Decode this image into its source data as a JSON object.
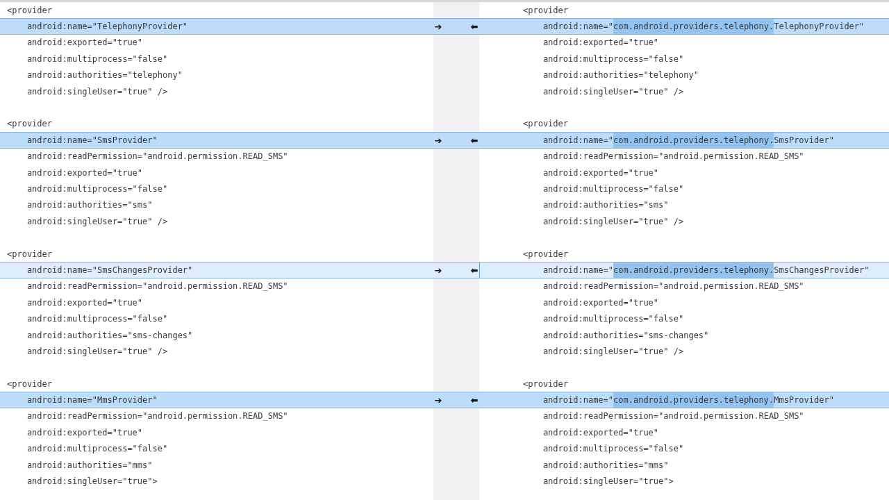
{
  "diff": {
    "blocks": [
      {
        "rows": [
          {
            "left": "<provider",
            "right": [
              {
                "text": "<provider",
                "inserted": false
              }
            ],
            "changed": false,
            "selected": false
          },
          {
            "left": "    android:name=\"TelephonyProvider\"",
            "right": [
              {
                "text": "    android:name=\"",
                "inserted": false
              },
              {
                "text": "com.android.providers.telephony.",
                "inserted": true
              },
              {
                "text": "TelephonyProvider\"",
                "inserted": false
              }
            ],
            "changed": true,
            "selected": false,
            "merge_right": "➔",
            "merge_left": "⬅"
          },
          {
            "left": "    android:exported=\"true\"",
            "right": [
              {
                "text": "    android:exported=\"true\"",
                "inserted": false
              }
            ],
            "changed": false,
            "selected": false
          },
          {
            "left": "    android:multiprocess=\"false\"",
            "right": [
              {
                "text": "    android:multiprocess=\"false\"",
                "inserted": false
              }
            ],
            "changed": false,
            "selected": false
          },
          {
            "left": "    android:authorities=\"telephony\"",
            "right": [
              {
                "text": "    android:authorities=\"telephony\"",
                "inserted": false
              }
            ],
            "changed": false,
            "selected": false
          },
          {
            "left": "    android:singleUser=\"true\" />",
            "right": [
              {
                "text": "    android:singleUser=\"true\" />",
                "inserted": false
              }
            ],
            "changed": false,
            "selected": false
          }
        ]
      },
      {
        "rows": [
          {
            "left": "<provider",
            "right": [
              {
                "text": "<provider",
                "inserted": false
              }
            ],
            "changed": false,
            "selected": false
          },
          {
            "left": "    android:name=\"SmsProvider\"",
            "right": [
              {
                "text": "    android:name=\"",
                "inserted": false
              },
              {
                "text": "com.android.providers.telephony.",
                "inserted": true
              },
              {
                "text": "SmsProvider\"",
                "inserted": false
              }
            ],
            "changed": true,
            "selected": false,
            "merge_right": "➔",
            "merge_left": "⬅"
          },
          {
            "left": "    android:readPermission=\"android.permission.READ_SMS\"",
            "right": [
              {
                "text": "    android:readPermission=\"android.permission.READ_SMS\"",
                "inserted": false
              }
            ],
            "changed": false,
            "selected": false
          },
          {
            "left": "    android:exported=\"true\"",
            "right": [
              {
                "text": "    android:exported=\"true\"",
                "inserted": false
              }
            ],
            "changed": false,
            "selected": false
          },
          {
            "left": "    android:multiprocess=\"false\"",
            "right": [
              {
                "text": "    android:multiprocess=\"false\"",
                "inserted": false
              }
            ],
            "changed": false,
            "selected": false
          },
          {
            "left": "    android:authorities=\"sms\"",
            "right": [
              {
                "text": "    android:authorities=\"sms\"",
                "inserted": false
              }
            ],
            "changed": false,
            "selected": false
          },
          {
            "left": "    android:singleUser=\"true\" />",
            "right": [
              {
                "text": "    android:singleUser=\"true\" />",
                "inserted": false
              }
            ],
            "changed": false,
            "selected": false
          }
        ]
      },
      {
        "rows": [
          {
            "left": "<provider",
            "right": [
              {
                "text": "<provider",
                "inserted": false
              }
            ],
            "changed": false,
            "selected": false
          },
          {
            "left": "    android:name=\"SmsChangesProvider\"",
            "right": [
              {
                "text": "    android:name=\"",
                "inserted": false
              },
              {
                "text": "com.android.providers.telephony.",
                "inserted": true
              },
              {
                "text": "SmsChangesProvider\"",
                "inserted": false
              }
            ],
            "changed": true,
            "selected": true,
            "merge_right": "➔",
            "merge_left": "⬅"
          },
          {
            "left": "    android:readPermission=\"android.permission.READ_SMS\"",
            "right": [
              {
                "text": "    android:readPermission=\"android.permission.READ_SMS\"",
                "inserted": false
              }
            ],
            "changed": false,
            "selected": false
          },
          {
            "left": "    android:exported=\"true\"",
            "right": [
              {
                "text": "    android:exported=\"true\"",
                "inserted": false
              }
            ],
            "changed": false,
            "selected": false
          },
          {
            "left": "    android:multiprocess=\"false\"",
            "right": [
              {
                "text": "    android:multiprocess=\"false\"",
                "inserted": false
              }
            ],
            "changed": false,
            "selected": false
          },
          {
            "left": "    android:authorities=\"sms-changes\"",
            "right": [
              {
                "text": "    android:authorities=\"sms-changes\"",
                "inserted": false
              }
            ],
            "changed": false,
            "selected": false
          },
          {
            "left": "    android:singleUser=\"true\" />",
            "right": [
              {
                "text": "    android:singleUser=\"true\" />",
                "inserted": false
              }
            ],
            "changed": false,
            "selected": false
          }
        ]
      },
      {
        "rows": [
          {
            "left": "<provider",
            "right": [
              {
                "text": "<provider",
                "inserted": false
              }
            ],
            "changed": false,
            "selected": false
          },
          {
            "left": "    android:name=\"MmsProvider\"",
            "right": [
              {
                "text": "    android:name=\"",
                "inserted": false
              },
              {
                "text": "com.android.providers.telephony.",
                "inserted": true
              },
              {
                "text": "MmsProvider\"",
                "inserted": false
              }
            ],
            "changed": true,
            "selected": false,
            "merge_right": "➔",
            "merge_left": "⬅"
          },
          {
            "left": "    android:readPermission=\"android.permission.READ_SMS\"",
            "right": [
              {
                "text": "    android:readPermission=\"android.permission.READ_SMS\"",
                "inserted": false
              }
            ],
            "changed": false,
            "selected": false
          },
          {
            "left": "    android:exported=\"true\"",
            "right": [
              {
                "text": "    android:exported=\"true\"",
                "inserted": false
              }
            ],
            "changed": false,
            "selected": false
          },
          {
            "left": "    android:multiprocess=\"false\"",
            "right": [
              {
                "text": "    android:multiprocess=\"false\"",
                "inserted": false
              }
            ],
            "changed": false,
            "selected": false
          },
          {
            "left": "    android:authorities=\"mms\"",
            "right": [
              {
                "text": "    android:authorities=\"mms\"",
                "inserted": false
              }
            ],
            "changed": false,
            "selected": false
          },
          {
            "left": "    android:singleUser=\"true\">",
            "right": [
              {
                "text": "    android:singleUser=\"true\">",
                "inserted": false
              }
            ],
            "changed": false,
            "selected": false
          }
        ]
      }
    ]
  }
}
